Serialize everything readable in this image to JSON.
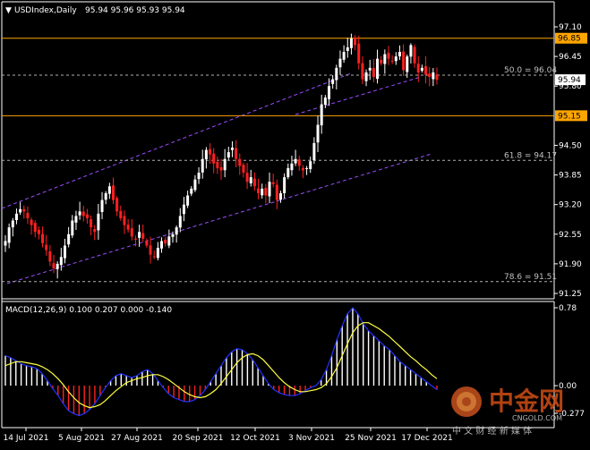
{
  "header": {
    "symbol": "USDIndex,Daily",
    "ohlc": "95.94 95.96 95.93 95.94",
    "menu_glyph": "▼"
  },
  "price_axis": {
    "ticks": [
      "97.10",
      "96.45",
      "95.80",
      "94.50",
      "93.85",
      "93.20",
      "92.55",
      "91.90",
      "91.25"
    ],
    "tick_values": [
      97.1,
      96.45,
      95.8,
      94.5,
      93.85,
      93.2,
      92.55,
      91.9,
      91.25
    ],
    "current_price": "95.94",
    "current_value": 95.94
  },
  "levels": [
    {
      "price_label": "96.85",
      "value": 96.85,
      "color": "#ffa500"
    },
    {
      "price_label": "95.15",
      "value": 95.15,
      "color": "#ffa500"
    }
  ],
  "fib_levels": [
    {
      "text": "50.0 = 96.04",
      "value": 96.04
    },
    {
      "text": "61.8 = 94.17",
      "value": 94.17
    },
    {
      "text": "78.6 = 91.51",
      "value": 91.51
    }
  ],
  "channel": {
    "color": "#9a4dff"
  },
  "date_axis": {
    "labels": [
      "14 Jul 2021",
      "5 Aug 2021",
      "27 Aug 2021",
      "20 Sep 2021",
      "12 Oct 2021",
      "3 Nov 2021",
      "25 Nov 2021",
      "17 Dec 2021"
    ]
  },
  "macd": {
    "title": "MACD(12,26,9) 0.100 0.207 0.000 -0.140",
    "axis_ticks": [
      "0.78",
      "0.00",
      "-0.277"
    ],
    "axis_values": [
      0.78,
      0.0,
      -0.277
    ]
  },
  "watermark": {
    "brand": "中金网",
    "domain": "CNGOLD.COM",
    "tagline": "中 文 财 经 新 媒 体"
  },
  "colors": {
    "bull": "#ffffff",
    "bear": "#ff2020",
    "signal": "#ffff40",
    "macd_line": "#2233ff",
    "hist_pos": "#ffffff",
    "hist_neg": "#ff2020",
    "level": "#ffa500",
    "channel": "#9a4dff"
  },
  "chart_data": {
    "type": "candlestick",
    "title": "USDIndex,Daily",
    "ylim": [
      91.25,
      97.1
    ],
    "x_labels": [
      "14 Jul 2021",
      "5 Aug 2021",
      "27 Aug 2021",
      "20 Sep 2021",
      "12 Oct 2021",
      "3 Nov 2021",
      "25 Nov 2021",
      "17 Dec 2021"
    ],
    "close_series": [
      92.4,
      92.7,
      92.85,
      93.0,
      93.1,
      93.05,
      92.9,
      92.75,
      92.6,
      92.55,
      92.35,
      92.2,
      91.95,
      91.8,
      91.9,
      92.05,
      92.3,
      92.55,
      92.85,
      92.95,
      93.05,
      92.95,
      92.9,
      92.7,
      92.6,
      93.0,
      93.3,
      93.45,
      93.6,
      93.3,
      93.05,
      92.9,
      92.75,
      92.65,
      92.5,
      92.45,
      92.6,
      92.45,
      92.3,
      92.1,
      92.05,
      92.25,
      92.4,
      92.35,
      92.5,
      92.55,
      92.7,
      92.95,
      93.2,
      93.4,
      93.55,
      93.75,
      93.9,
      94.2,
      94.4,
      94.3,
      94.1,
      94.0,
      93.95,
      94.2,
      94.35,
      94.45,
      94.2,
      94.05,
      93.9,
      93.7,
      93.8,
      93.6,
      93.45,
      93.55,
      93.4,
      93.7,
      93.65,
      93.3,
      93.45,
      93.8,
      94.0,
      94.1,
      94.2,
      94.05,
      93.95,
      94.0,
      94.15,
      94.55,
      94.95,
      95.4,
      95.55,
      95.8,
      95.95,
      96.2,
      96.4,
      96.55,
      96.65,
      96.85,
      96.7,
      96.3,
      95.95,
      96.1,
      96.2,
      96.0,
      96.4,
      96.3,
      96.5,
      96.4,
      96.35,
      96.45,
      96.55,
      96.15,
      96.45,
      96.7,
      96.3,
      96.1,
      96.2,
      96.05,
      96.0,
      96.1,
      95.94
    ],
    "macd_line": [
      0.3,
      0.28,
      0.25,
      0.22,
      0.2,
      0.19,
      0.17,
      0.12,
      0.05,
      -0.03,
      -0.1,
      -0.18,
      -0.25,
      -0.28,
      -0.3,
      -0.28,
      -0.24,
      -0.18,
      -0.1,
      -0.02,
      0.05,
      0.1,
      0.12,
      0.1,
      0.08,
      0.1,
      0.14,
      0.16,
      0.12,
      0.05,
      -0.02,
      -0.08,
      -0.12,
      -0.14,
      -0.16,
      -0.16,
      -0.14,
      -0.1,
      -0.04,
      0.04,
      0.12,
      0.2,
      0.28,
      0.34,
      0.37,
      0.36,
      0.32,
      0.26,
      0.18,
      0.1,
      0.02,
      -0.04,
      -0.07,
      -0.09,
      -0.1,
      -0.1,
      -0.08,
      -0.05,
      -0.02,
      0.0,
      0.06,
      0.16,
      0.3,
      0.46,
      0.6,
      0.72,
      0.78,
      0.72,
      0.62,
      0.55,
      0.5,
      0.45,
      0.4,
      0.36,
      0.3,
      0.24,
      0.2,
      0.16,
      0.12,
      0.08,
      0.04,
      0.0,
      -0.04
    ],
    "signal_line": [
      0.2,
      0.22,
      0.24,
      0.24,
      0.23,
      0.22,
      0.21,
      0.19,
      0.16,
      0.12,
      0.07,
      0.01,
      -0.06,
      -0.12,
      -0.17,
      -0.2,
      -0.22,
      -0.21,
      -0.19,
      -0.15,
      -0.1,
      -0.05,
      -0.01,
      0.03,
      0.05,
      0.07,
      0.08,
      0.1,
      0.11,
      0.11,
      0.09,
      0.06,
      0.02,
      -0.02,
      -0.06,
      -0.09,
      -0.11,
      -0.12,
      -0.11,
      -0.08,
      -0.04,
      0.02,
      0.09,
      0.16,
      0.23,
      0.28,
      0.31,
      0.32,
      0.3,
      0.26,
      0.2,
      0.14,
      0.08,
      0.03,
      -0.01,
      -0.04,
      -0.06,
      -0.06,
      -0.05,
      -0.04,
      -0.02,
      0.02,
      0.09,
      0.18,
      0.3,
      0.42,
      0.53,
      0.6,
      0.63,
      0.63,
      0.6,
      0.57,
      0.53,
      0.49,
      0.44,
      0.39,
      0.34,
      0.29,
      0.25,
      0.2,
      0.16,
      0.11,
      0.07
    ]
  }
}
